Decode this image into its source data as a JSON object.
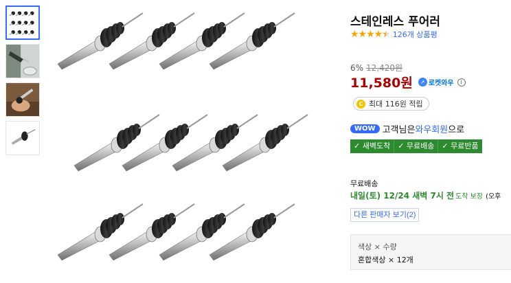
{
  "thumbnails": [
    {
      "icon": "pourers-grid-thumbnail",
      "active": true
    },
    {
      "icon": "pouring-bottle-thumbnail",
      "active": false
    },
    {
      "icon": "hand-holding-pourer-thumbnail",
      "active": false
    },
    {
      "icon": "single-pourer-thumbnail",
      "active": false
    }
  ],
  "main_image": {
    "icon": "pourers-product-image"
  },
  "product": {
    "title": "스테인레스 푸어러",
    "rating": 4.5,
    "review_count": "126개 상품평"
  },
  "price": {
    "discount_rate": "6%",
    "original_price": "12,420원",
    "sale_price": "11,580원",
    "rocket_label": "로켓와우",
    "info_icon": "i"
  },
  "cashback": {
    "coin_icon": "C",
    "text": "최대 116원 적립"
  },
  "wow": {
    "badge": "WOW",
    "prefix": "고객님은 ",
    "link": "와우회원",
    "suffix": "으로"
  },
  "benefits": [
    "✓ 새벽도착",
    "✓ 무료배송",
    "✓ 무료반품"
  ],
  "shipping": {
    "label": "무료배송",
    "date": "내일(토) 12/24 새벽 7시 전",
    "guarantee": "도착 보장",
    "extra": "(오후"
  },
  "other_sellers": "다른 판매자 보기(2)",
  "option": {
    "label": "색상 × 수량",
    "value": "혼합색상 × 12개"
  },
  "colors": {
    "accent": "#346aff",
    "price": "#ae0000",
    "green": "#2c8a2f",
    "star": "#f5a300"
  }
}
